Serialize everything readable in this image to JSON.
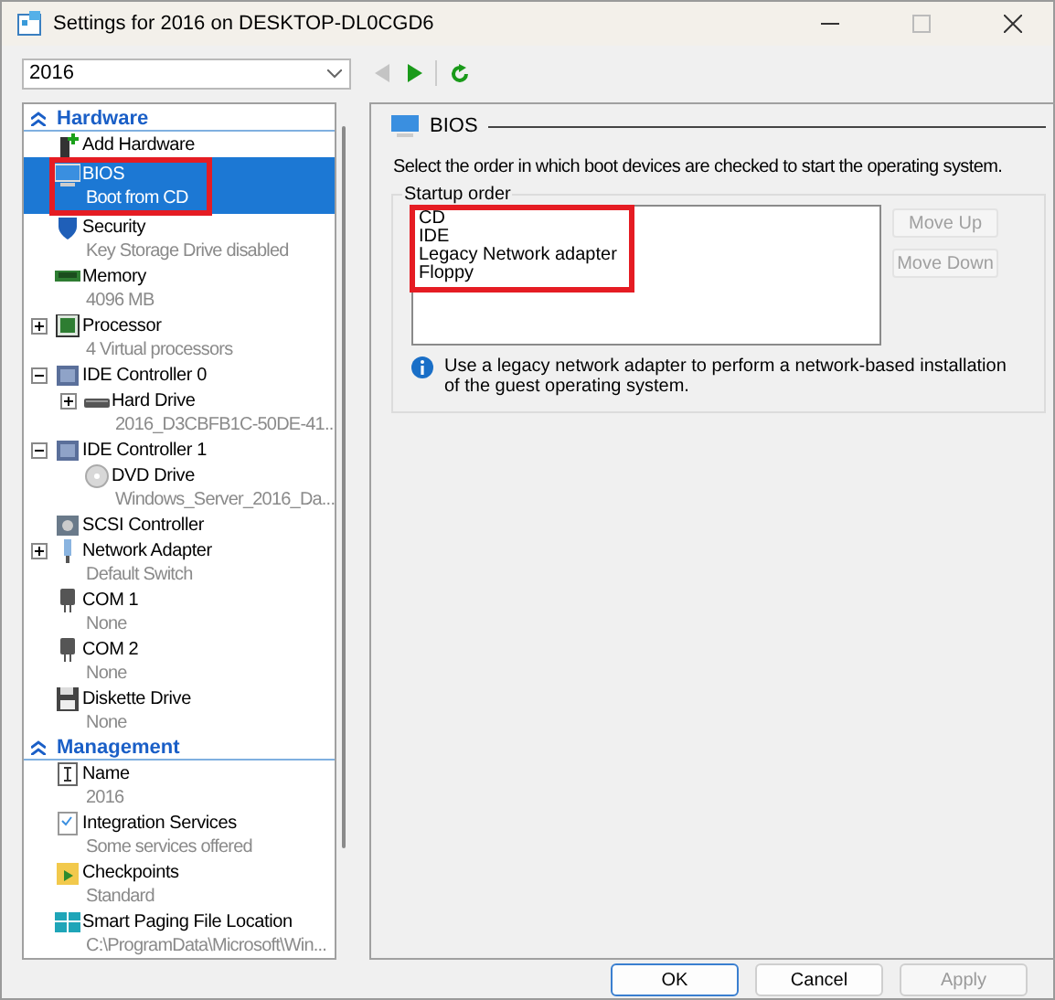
{
  "window": {
    "title": "Settings for 2016 on DESKTOP-DL0CGD6"
  },
  "vm_selector": {
    "value": "2016"
  },
  "nav_buttons": [
    {
      "kind": "back",
      "disabled": true
    },
    {
      "kind": "forward",
      "disabled": false
    },
    {
      "kind": "refresh",
      "disabled": false
    }
  ],
  "sections": [
    {
      "title": "Hardware",
      "items": [
        {
          "label": "Add Hardware",
          "selected": false
        },
        {
          "label": "BIOS",
          "detail": "Boot from CD",
          "selected": true,
          "highlighted": true
        },
        {
          "label": "Security",
          "detail": "Key Storage Drive disabled",
          "selected": false
        },
        {
          "label": "Memory",
          "detail": "4096 MB",
          "selected": false
        },
        {
          "label": "Processor",
          "detail": "4 Virtual processors",
          "selected": false,
          "expanded": false
        },
        {
          "label": "IDE Controller 0",
          "selected": false,
          "expanded": true,
          "children": [
            {
              "label": "Hard Drive",
              "detail": "2016_D3CBFB1C-50DE-41...",
              "selected": false,
              "expanded": false
            }
          ]
        },
        {
          "label": "IDE Controller 1",
          "selected": false,
          "expanded": true,
          "children": [
            {
              "label": "DVD Drive",
              "detail": "Windows_Server_2016_Da...",
              "selected": false
            }
          ]
        },
        {
          "label": "SCSI Controller",
          "selected": false
        },
        {
          "label": "Network Adapter",
          "detail": "Default Switch",
          "selected": false,
          "expanded": false
        },
        {
          "label": "COM 1",
          "detail": "None",
          "selected": false
        },
        {
          "label": "COM 2",
          "detail": "None",
          "selected": false
        },
        {
          "label": "Diskette Drive",
          "detail": "None",
          "selected": false
        }
      ]
    },
    {
      "title": "Management",
      "items": [
        {
          "label": "Name",
          "detail": "2016",
          "selected": false
        },
        {
          "label": "Integration Services",
          "detail": "Some services offered",
          "selected": false
        },
        {
          "label": "Checkpoints",
          "detail": "Standard",
          "selected": false
        },
        {
          "label": "Smart Paging File Location",
          "detail": "C:\\ProgramData\\Microsoft\\Win...",
          "selected": false
        }
      ]
    }
  ],
  "panel": {
    "title": "BIOS",
    "description": "Select the order in which boot devices are checked to start the operating system.",
    "startup_order": {
      "label": "Startup order",
      "highlighted": true,
      "items": [
        "CD",
        "IDE",
        "Legacy Network adapter",
        "Floppy"
      ],
      "buttons": [
        {
          "label": "Move Up",
          "disabled": true
        },
        {
          "label": "Move Down",
          "disabled": true
        }
      ]
    },
    "note": "Use a legacy network adapter to perform a network-based installation of the guest operating system."
  },
  "buttons": [
    {
      "label": "OK",
      "default": true,
      "disabled": false
    },
    {
      "label": "Cancel",
      "default": false,
      "disabled": false
    },
    {
      "label": "Apply",
      "default": false,
      "disabled": true
    }
  ]
}
